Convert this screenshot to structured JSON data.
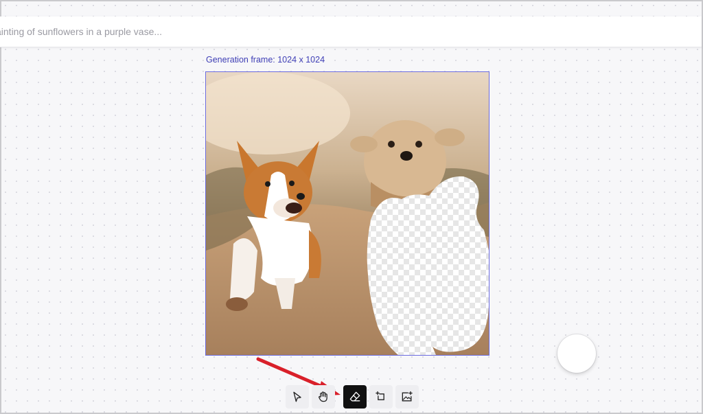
{
  "prompt": {
    "placeholder": "ainting of sunflowers in a purple vase..."
  },
  "generation_frame": {
    "label": "Generation frame: 1024 x 1024"
  },
  "toolbar": {
    "tools": [
      {
        "name": "select",
        "icon": "cursor-arrow-icon",
        "active": false
      },
      {
        "name": "pan",
        "icon": "hand-icon",
        "active": false
      },
      {
        "name": "eraser",
        "icon": "eraser-icon",
        "active": true
      },
      {
        "name": "add-frame",
        "icon": "add-frame-icon",
        "active": false
      },
      {
        "name": "upload-image",
        "icon": "image-plus-icon",
        "active": false
      }
    ]
  },
  "colors": {
    "accent": "#3f3fb6",
    "frame_border": "#6b6be0",
    "annotation_arrow": "#d9202a",
    "active_tool": "#111111"
  }
}
